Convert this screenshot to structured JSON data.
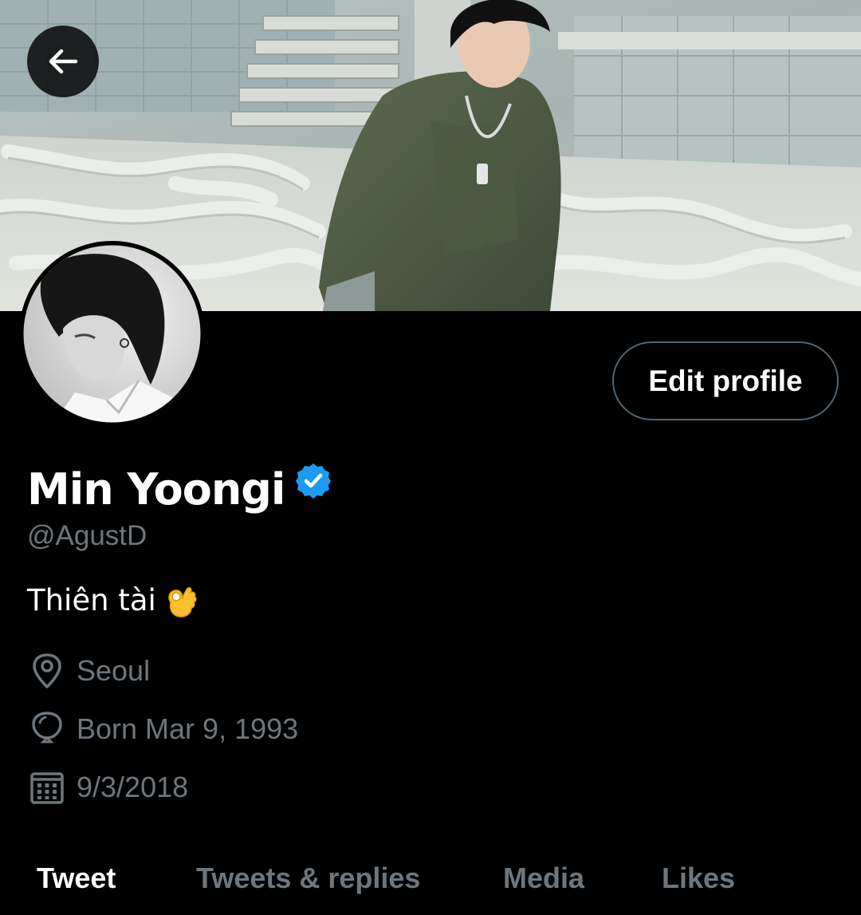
{
  "header": {
    "back_icon": "arrow-left-icon",
    "banner_image": "cover-photo"
  },
  "profile": {
    "avatar": "profile-photo",
    "edit_profile_label": "Edit profile",
    "display_name": "Min Yoongi",
    "verified_icon": "verified-badge-icon",
    "handle": "@AgustD",
    "bio": "Thiên tài",
    "bio_emoji": "ok-hand-emoji",
    "location_icon": "location-pin-icon",
    "location": "Seoul",
    "birthday_icon": "balloon-icon",
    "birthday": "Born Mar 9, 1993",
    "joined_icon": "calendar-icon",
    "joined": "9/3/2018"
  },
  "tabs": [
    {
      "label": "Tweet",
      "active": true
    },
    {
      "label": "Tweets & replies",
      "active": false
    },
    {
      "label": "Media",
      "active": false
    },
    {
      "label": "Likes",
      "active": false
    }
  ],
  "colors": {
    "background": "#000000",
    "primary_text": "#ffffff",
    "secondary_text": "#6e767d",
    "button_border": "#536471",
    "verified_blue": "#1d9bf0"
  }
}
